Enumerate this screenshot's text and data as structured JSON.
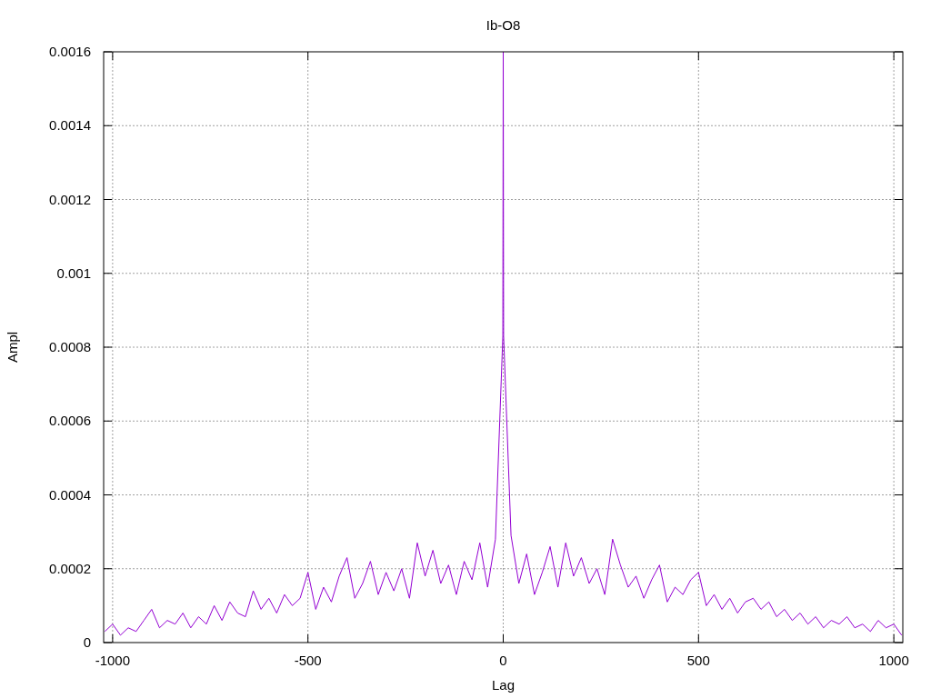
{
  "plot": {
    "chart_data": {
      "type": "line",
      "grid": true,
      "title": "Ib-O8",
      "xlabel": "Lag",
      "ylabel": "Ampl",
      "xlim": [
        -1023,
        1023
      ],
      "ylim": [
        0,
        0.0016
      ],
      "xticks": [
        -1000,
        -500,
        0,
        500,
        1000
      ],
      "yticks": [
        0,
        0.0002,
        0.0004,
        0.0006,
        0.0008,
        0.001,
        0.0012,
        0.0014,
        0.0016
      ],
      "x": [
        -1020,
        -1000,
        -980,
        -960,
        -940,
        -920,
        -900,
        -880,
        -860,
        -840,
        -820,
        -800,
        -780,
        -760,
        -740,
        -720,
        -700,
        -680,
        -660,
        -640,
        -620,
        -600,
        -580,
        -560,
        -540,
        -520,
        -500,
        -480,
        -460,
        -440,
        -420,
        -400,
        -380,
        -360,
        -340,
        -320,
        -300,
        -280,
        -260,
        -240,
        -220,
        -200,
        -180,
        -160,
        -140,
        -120,
        -100,
        -80,
        -60,
        -40,
        -20,
        -1,
        0,
        1,
        20,
        40,
        60,
        80,
        100,
        120,
        140,
        160,
        180,
        200,
        220,
        240,
        260,
        280,
        300,
        320,
        340,
        360,
        380,
        400,
        420,
        440,
        460,
        480,
        500,
        520,
        540,
        560,
        580,
        600,
        620,
        640,
        660,
        680,
        700,
        720,
        740,
        760,
        780,
        800,
        820,
        840,
        860,
        880,
        900,
        920,
        940,
        960,
        980,
        1000,
        1020
      ],
      "series": [
        {
          "color": "#9400d3",
          "values": [
            3e-05,
            5e-05,
            2e-05,
            4e-05,
            3e-05,
            6e-05,
            9e-05,
            4e-05,
            6e-05,
            5e-05,
            8e-05,
            4e-05,
            7e-05,
            5e-05,
            0.0001,
            6e-05,
            0.00011,
            8e-05,
            7e-05,
            0.00014,
            9e-05,
            0.00012,
            8e-05,
            0.00013,
            0.0001,
            0.00012,
            0.00019,
            9e-05,
            0.00015,
            0.00011,
            0.00018,
            0.00023,
            0.00012,
            0.00016,
            0.00022,
            0.00013,
            0.00019,
            0.00014,
            0.0002,
            0.00012,
            0.00027,
            0.00018,
            0.00025,
            0.00016,
            0.00021,
            0.00013,
            0.00022,
            0.00017,
            0.00027,
            0.00015,
            0.00028,
            0.00083,
            0.0016,
            0.00083,
            0.00029,
            0.00016,
            0.00024,
            0.00013,
            0.00019,
            0.00026,
            0.00015,
            0.00027,
            0.00018,
            0.00023,
            0.00016,
            0.0002,
            0.00013,
            0.00028,
            0.00021,
            0.00015,
            0.00018,
            0.00012,
            0.00017,
            0.00021,
            0.00011,
            0.00015,
            0.00013,
            0.00017,
            0.00019,
            0.0001,
            0.00013,
            9e-05,
            0.00012,
            8e-05,
            0.00011,
            0.00012,
            9e-05,
            0.00011,
            7e-05,
            9e-05,
            6e-05,
            8e-05,
            5e-05,
            7e-05,
            4e-05,
            6e-05,
            5e-05,
            7e-05,
            4e-05,
            5e-05,
            3e-05,
            6e-05,
            4e-05,
            5e-05,
            2e-05
          ]
        }
      ]
    }
  }
}
